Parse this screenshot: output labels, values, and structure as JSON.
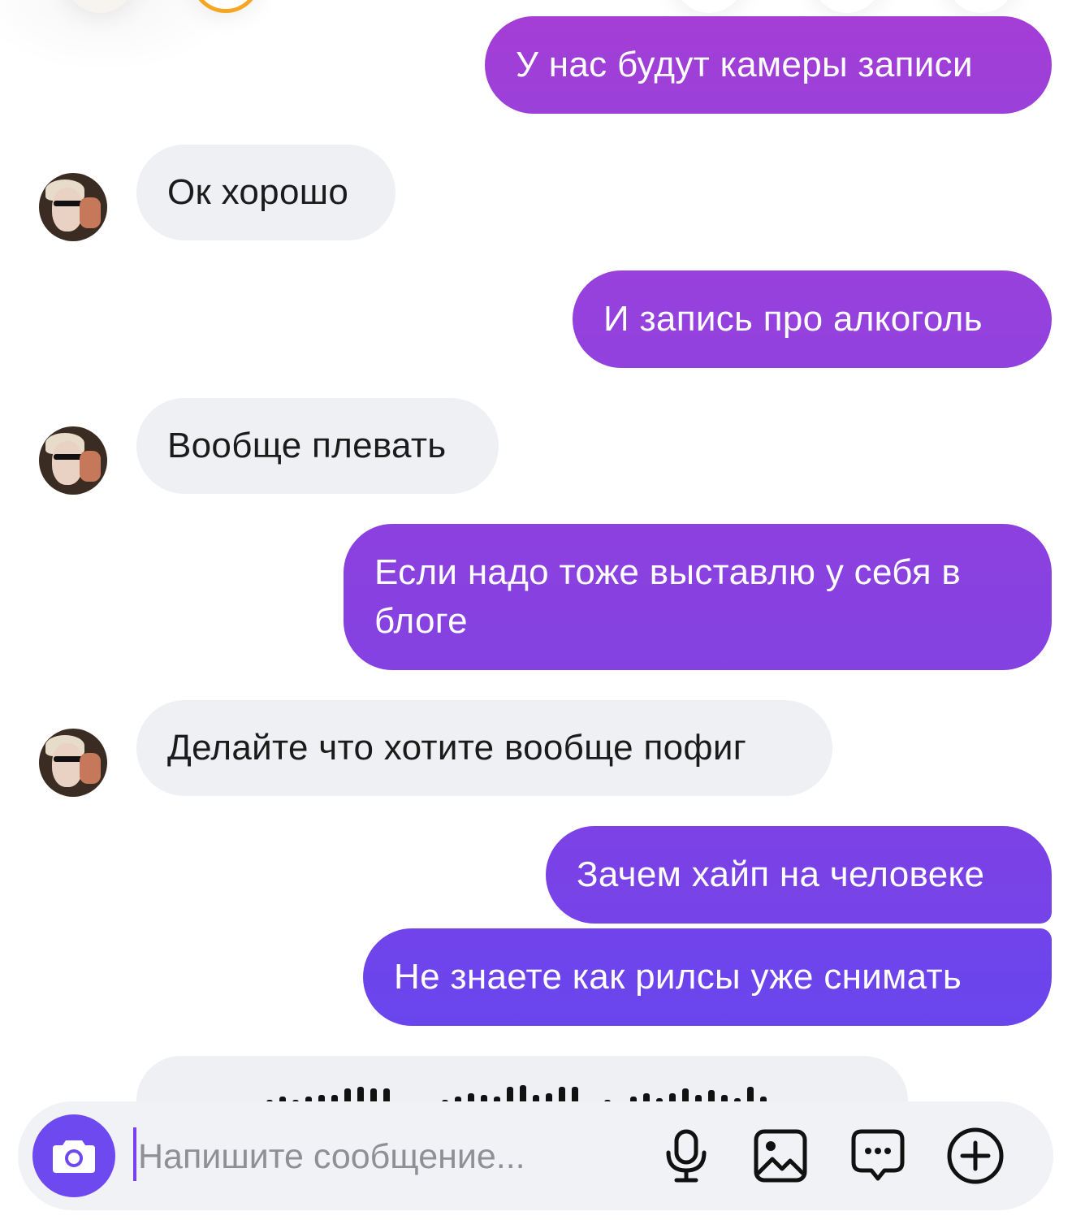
{
  "messages": [
    {
      "side": "out",
      "text": "У нас будут камеры записи"
    },
    {
      "side": "in",
      "text": "Ок хорошо"
    },
    {
      "side": "out",
      "text": "И запись про алкоголь"
    },
    {
      "side": "in",
      "text": "Вообще плевать"
    },
    {
      "side": "out",
      "line1": "Если надо тоже выставлю у себя в",
      "line2": "блоге"
    },
    {
      "side": "in",
      "text": "Делайте что хотите вообще пофиг"
    },
    {
      "side": "out",
      "text": "Зачем хайп на человеке"
    },
    {
      "side": "out",
      "text": "Не знаете как рилсы уже снимать"
    }
  ],
  "voice_message": {
    "type": "audio"
  },
  "composer": {
    "placeholder": "Напишите сообщение..."
  },
  "icons": {
    "camera": "camera-icon",
    "mic": "microphone-icon",
    "gallery": "image-icon",
    "chat": "message-icon",
    "add": "plus-circle-icon"
  },
  "colors": {
    "outgoing_top": "#a13fd6",
    "outgoing_bottom": "#6a45ee",
    "incoming": "#eff0f3",
    "accent": "#6e49f0"
  }
}
